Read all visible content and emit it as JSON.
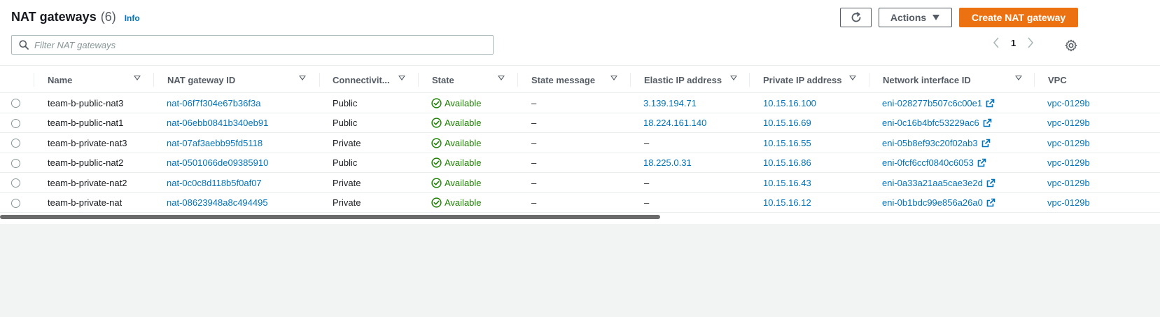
{
  "header": {
    "title": "NAT gateways",
    "count": "(6)",
    "info": "Info"
  },
  "toolbar": {
    "actions_label": "Actions",
    "create_label": "Create NAT gateway",
    "refresh_icon": "refresh-icon",
    "settings_icon": "gear-icon"
  },
  "search": {
    "placeholder": "Filter NAT gateways"
  },
  "pagination": {
    "current_page": "1"
  },
  "columns": [
    "Name",
    "NAT gateway ID",
    "Connectivit...",
    "State",
    "State message",
    "Elastic IP address",
    "Private IP address",
    "Network interface ID",
    "VPC"
  ],
  "rows": [
    {
      "name": "team-b-public-nat3",
      "id": "nat-06f7f304e67b36f3a",
      "connectivity": "Public",
      "state": "Available",
      "message": "–",
      "eip": "3.139.194.71",
      "private_ip": "10.15.16.100",
      "eni": "eni-028277b507c6c00e1",
      "vpc": "vpc-0129b"
    },
    {
      "name": "team-b-public-nat1",
      "id": "nat-06ebb0841b340eb91",
      "connectivity": "Public",
      "state": "Available",
      "message": "–",
      "eip": "18.224.161.140",
      "private_ip": "10.15.16.69",
      "eni": "eni-0c16b4bfc53229ac6",
      "vpc": "vpc-0129b"
    },
    {
      "name": "team-b-private-nat3",
      "id": "nat-07af3aebb95fd5118",
      "connectivity": "Private",
      "state": "Available",
      "message": "–",
      "eip": "–",
      "private_ip": "10.15.16.55",
      "eni": "eni-05b8ef93c20f02ab3",
      "vpc": "vpc-0129b"
    },
    {
      "name": "team-b-public-nat2",
      "id": "nat-0501066de09385910",
      "connectivity": "Public",
      "state": "Available",
      "message": "–",
      "eip": "18.225.0.31",
      "private_ip": "10.15.16.86",
      "eni": "eni-0fcf6ccf0840c6053",
      "vpc": "vpc-0129b"
    },
    {
      "name": "team-b-private-nat2",
      "id": "nat-0c0c8d118b5f0af07",
      "connectivity": "Private",
      "state": "Available",
      "message": "–",
      "eip": "–",
      "private_ip": "10.15.16.43",
      "eni": "eni-0a33a21aa5cae3e2d",
      "vpc": "vpc-0129b"
    },
    {
      "name": "team-b-private-nat",
      "id": "nat-08623948a8c494495",
      "connectivity": "Private",
      "state": "Available",
      "message": "–",
      "eip": "–",
      "private_ip": "10.15.16.12",
      "eni": "eni-0b1bdc99e856a26a0",
      "vpc": "vpc-0129b"
    }
  ],
  "colors": {
    "link": "#0073bb",
    "available": "#1d8102",
    "primary": "#ec7211"
  }
}
